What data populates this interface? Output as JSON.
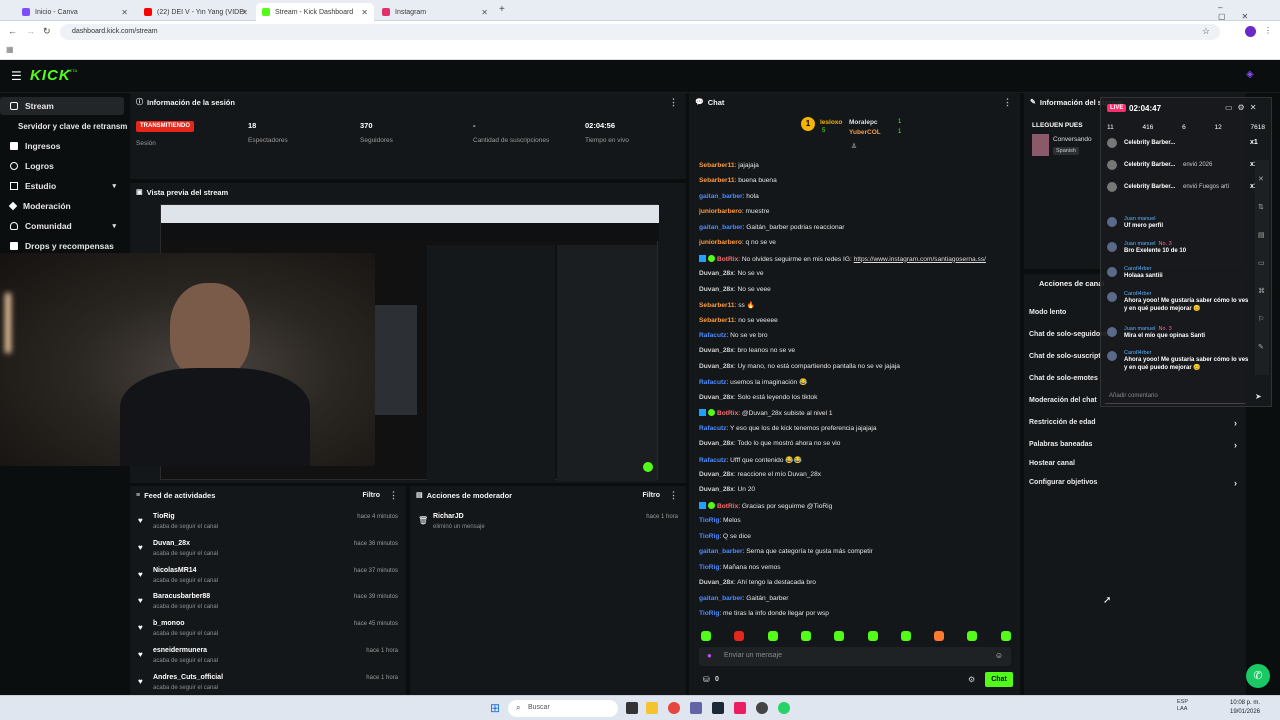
{
  "browser": {
    "tabs": [
      {
        "label": "Inicio - Canva",
        "color": "#7c4dff"
      },
      {
        "label": "(22) DEI V - Yin Yang (VIDEO O",
        "color": "#ff0000"
      },
      {
        "label": "Stream - Kick Dashboard",
        "color": "#53fc18"
      },
      {
        "label": "Instagram",
        "color": "#e1306c"
      }
    ],
    "url": "dashboard.kick.com/stream"
  },
  "kick": {
    "logo": "KICK",
    "beta": "BETA"
  },
  "sidebar": {
    "stream": "Stream",
    "items": [
      "Servidor y clave de retransm",
      "Ingresos",
      "Logros",
      "Estudio",
      "Moderación",
      "Comunidad",
      "Drops y recompensas"
    ]
  },
  "info": {
    "title": "Información de la sesión",
    "status_badge": "TRANSMITIENDO",
    "session_label": "Sesión",
    "stats": [
      {
        "value": "18",
        "label": "Espectadores"
      },
      {
        "value": "370",
        "label": "Seguidores"
      },
      {
        "value": "-",
        "label": "Cantidad de suscripciones"
      },
      {
        "value": "02:04:56",
        "label": "Tiempo en vivo"
      }
    ]
  },
  "preview": {
    "title": "Vista previa del stream"
  },
  "feed": {
    "title": "Feed de actividades",
    "filter": "Filtro",
    "rows": [
      {
        "name": "TioRig",
        "sub": "acaba de seguir el canal",
        "time": "hace 4 minutos"
      },
      {
        "name": "Duvan_28x",
        "sub": "acaba de seguir el canal",
        "time": "hace 36 minutos"
      },
      {
        "name": "NicolasMR14",
        "sub": "acaba de seguir el canal",
        "time": "hace 37 minutos"
      },
      {
        "name": "Baracusbarber88",
        "sub": "acaba de seguir el canal",
        "time": "hace 39 minutos"
      },
      {
        "name": "b_monoo",
        "sub": "acaba de seguir el canal",
        "time": "hace 45 minutos"
      },
      {
        "name": "esneidermunera",
        "sub": "acaba de seguir el canal",
        "time": "hace 1 hora"
      },
      {
        "name": "Andres_Cuts_official",
        "sub": "acaba de seguir el canal",
        "time": "hace 1 hora"
      }
    ]
  },
  "mod": {
    "title": "Acciones de moderador",
    "filter": "Filtro",
    "rows": [
      {
        "name": "RicharJD",
        "sub": "eliminó un mensaje",
        "time": "hace 1 hora"
      }
    ]
  },
  "chat": {
    "title": "Chat",
    "leaders": {
      "first": "lesloxo",
      "first_count": "5",
      "second": "Moralepc",
      "second_count": "1",
      "third": "YuberCOL",
      "third_count": "1"
    },
    "messages": [
      {
        "user": "Sebarber11",
        "text": ": jajajaja",
        "color": "#ff9a3c"
      },
      {
        "user": "Sebarber11",
        "text": ": buena buena",
        "color": "#ff9a3c"
      },
      {
        "user": "gaitan_barber",
        "text": ": hola",
        "color": "#4d8bff"
      },
      {
        "user": "juniorbarbero",
        "text": ": muestre",
        "color": "#ff9a3c"
      },
      {
        "user": "gaitan_barber",
        "text": ": Gaitán_barber podrias reaccionar",
        "color": "#4d8bff"
      },
      {
        "user": "juniorbarbero",
        "text": ": q no se ve",
        "color": "#ff9a3c"
      },
      {
        "user": "BotRix",
        "text": ": No olvides seguirme en mis redes IG: ",
        "color": "#ff6b6b",
        "link": "https://www.instagram.com/santiagoserna.ss/",
        "bot": true
      },
      {
        "user": "Duvan_28x",
        "text": ": No se ve",
        "color": "#cfcfcf"
      },
      {
        "user": "Duvan_28x",
        "text": ": No se veee",
        "color": "#cfcfcf"
      },
      {
        "user": "Sebarber11",
        "text": ": ss 🔥",
        "color": "#ff9a3c"
      },
      {
        "user": "Sebarber11",
        "text": ": no se veeeee",
        "color": "#ff9a3c"
      },
      {
        "user": "Rafacutz",
        "text": ": No se ve bro",
        "color": "#4d8bff"
      },
      {
        "user": "Duvan_28x",
        "text": ": bro leanos no se ve",
        "color": "#cfcfcf"
      },
      {
        "user": "Duvan_28x",
        "text": ": Uy mano, no está compartiendo pantalla no se ve jajaja",
        "color": "#cfcfcf"
      },
      {
        "user": "Rafacutz",
        "text": ": usemos la imaginación 😂",
        "color": "#4d8bff"
      },
      {
        "user": "Duvan_28x",
        "text": ": Solo está leyendo los tiktok",
        "color": "#cfcfcf"
      },
      {
        "user": "BotRix",
        "text": ": @Duvan_28x subiste al nivel 1",
        "color": "#ff6b6b",
        "bot": true
      },
      {
        "user": "Rafacutz",
        "text": ": Y eso que los de kick tenemos preferencia jajajaja",
        "color": "#4d8bff"
      },
      {
        "user": "Duvan_28x",
        "text": ": Todo lo que mostró ahora no se vio",
        "color": "#cfcfcf"
      },
      {
        "user": "Rafacutz",
        "text": ": Ufff que contenido 😂😂",
        "color": "#4d8bff"
      },
      {
        "user": "Duvan_28x",
        "text": ": reaccione el mío Duvan_28x",
        "color": "#cfcfcf"
      },
      {
        "user": "Duvan_28x",
        "text": ": Un 20",
        "color": "#cfcfcf"
      },
      {
        "user": "BotRix",
        "text": ": Gracias por seguirme @TioRig",
        "color": "#ff6b6b",
        "bot": true
      },
      {
        "user": "TioRig",
        "text": ": Melos",
        "color": "#4d8bff"
      },
      {
        "user": "TioRig",
        "text": ": Q se dice",
        "color": "#4d8bff"
      },
      {
        "user": "gaitan_barber",
        "text": ": Serna que categoría te gusta más competir",
        "color": "#4d8bff"
      },
      {
        "user": "TioRig",
        "text": ": Mañana nos vemos",
        "color": "#4d8bff"
      },
      {
        "user": "Duvan_28x",
        "text": ": Ahí tengo la destacada bro",
        "color": "#cfcfcf"
      },
      {
        "user": "gaitan_barber",
        "text": ": Gaitán_barber",
        "color": "#4d8bff"
      },
      {
        "user": "TioRig",
        "text": ": me tiras la info donde llegar por wsp",
        "color": "#4d8bff"
      }
    ],
    "input_placeholder": "Enviar un mensaje",
    "points": "0",
    "send": "Chat"
  },
  "stream_info": {
    "title": "Información del stream",
    "category": "LLEGUEN PUES",
    "subtitle": "Conversando",
    "lang": "Spanish"
  },
  "channel_actions": {
    "title": "Acciones de canal",
    "items": [
      "Modo lento",
      "Chat de solo-seguidores",
      "Chat de solo-suscript",
      "Chat de solo-emotes",
      "Moderación del chat",
      "Restricción de edad",
      "Palabras baneadas",
      "Hostear canal",
      "Configurar objetivos"
    ]
  },
  "overlay": {
    "live": "LIVE",
    "time": "02:04:47",
    "stats": [
      "11",
      "416",
      "6",
      "12",
      "7618"
    ],
    "gifts": [
      {
        "user": "Celebrity Barber...",
        "text": "",
        "count": "x1"
      },
      {
        "user": "Celebrity Barber...",
        "text": "envió 2026",
        "count": "x1"
      },
      {
        "user": "Celebrity Barber...",
        "text": "envió Fuegos arti",
        "count": "x1"
      }
    ],
    "comments": [
      {
        "user": "Juan manuel",
        "text": "Uf mero perfil"
      },
      {
        "user": "Juan manuel",
        "text": "Bro Exelente 10 de 10",
        "badge": "No. 3"
      },
      {
        "user": "CaroIl4rber",
        "text": "Holaaa santiii"
      },
      {
        "user": "CaroIl4rber",
        "text": "Ahora yooo! Me gustaría saber cómo lo ves y en qué puedo mejorar 😊"
      },
      {
        "user": "Juan manuel",
        "text": "Mira el mío que opinas Santi",
        "badge": "No. 3"
      },
      {
        "user": "CaroIl4rber",
        "text": "Ahora yooo! Me gustaría saber cómo lo ves y en qué puedo mejorar 😊"
      }
    ],
    "comment_placeholder": "Añadir comentario"
  },
  "taskbar": {
    "search": "Buscar",
    "lang": "ESP\nLAA",
    "time": "10:08 p. m.",
    "date": "19/01/2026"
  }
}
